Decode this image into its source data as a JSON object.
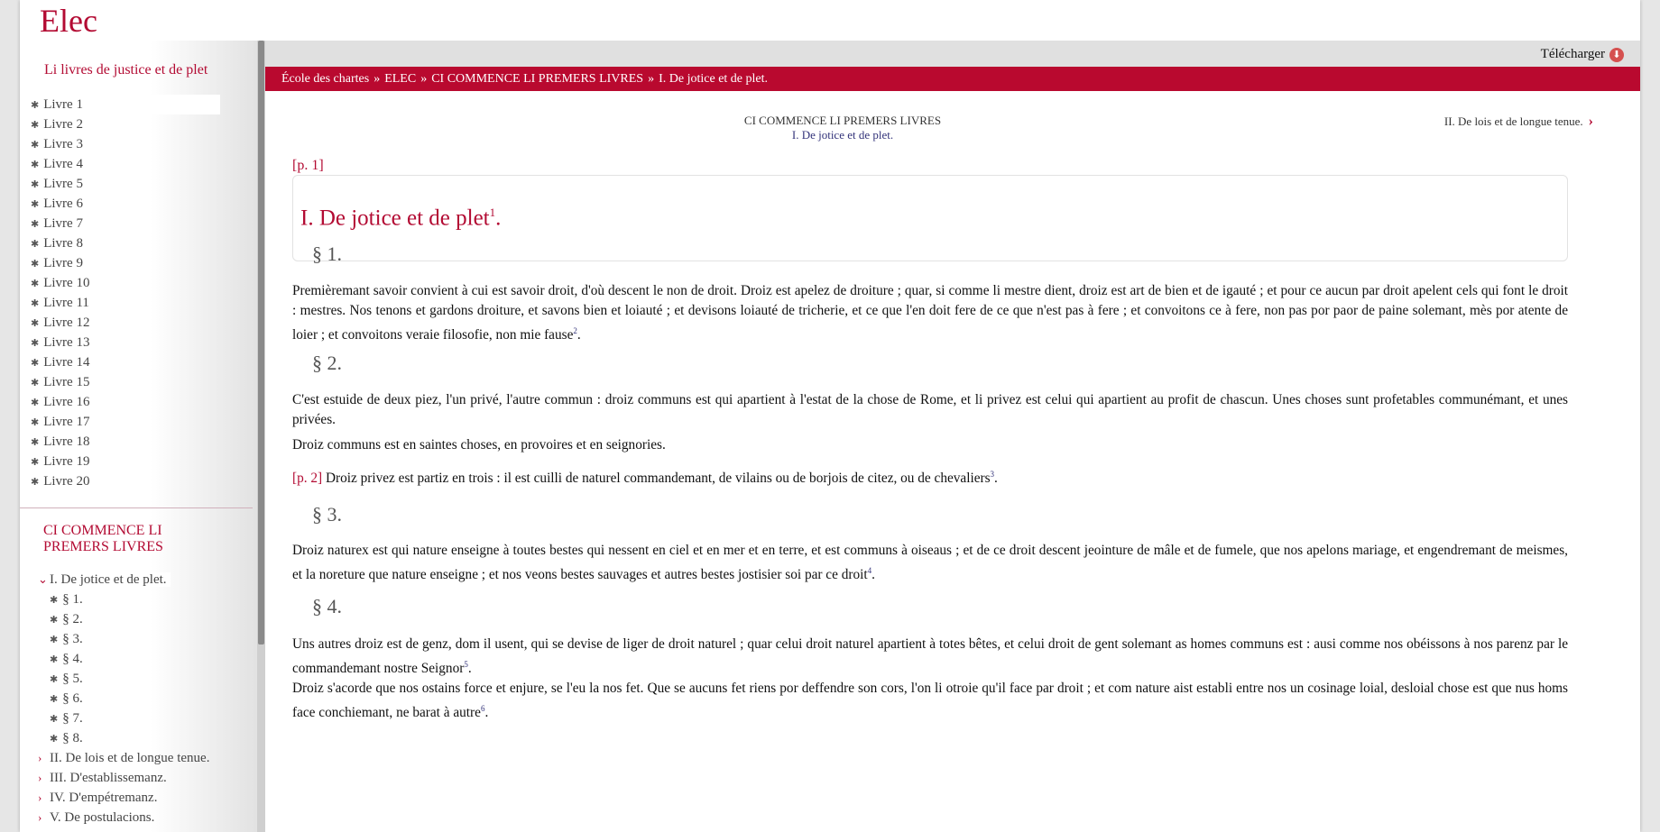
{
  "app": {
    "logo": "Elec"
  },
  "sidebar": {
    "title": "Li livres de justice et de plet",
    "books": [
      "Livre 1",
      "Livre 2",
      "Livre 3",
      "Livre 4",
      "Livre 5",
      "Livre 6",
      "Livre 7",
      "Livre 8",
      "Livre 9",
      "Livre 10",
      "Livre 11",
      "Livre 12",
      "Livre 13",
      "Livre 14",
      "Livre 15",
      "Livre 16",
      "Livre 17",
      "Livre 18",
      "Livre 19",
      "Livre 20"
    ],
    "section_title": "CI COMMENCE LI PREMERS LIVRES",
    "toc": {
      "current_chapter": "I. De jotice et de plet.",
      "paragraphs": [
        "§ 1.",
        "§ 2.",
        "§ 3.",
        "§ 4.",
        "§ 5.",
        "§ 6.",
        "§ 7.",
        "§ 8."
      ],
      "other_chapters": [
        "II. De lois et de longue tenue.",
        "III. D'establissemanz.",
        "IV. D'empétremanz.",
        "V. De postulacions."
      ]
    }
  },
  "topbar": {
    "download_label": "Télécharger"
  },
  "breadcrumb": [
    "École des chartes",
    "ELEC",
    "CI COMMENCE LI PREMERS LIVRES",
    "I. De jotice et de plet."
  ],
  "breadcrumb_separator": "»",
  "nav": {
    "book": "CI COMMENCE LI PREMERS LIVRES",
    "chapter": "I. De jotice et de plet.",
    "next": "II. De lois et de longue tenue."
  },
  "content": {
    "page1": "[p. 1]",
    "title": "I. De jotice et de plet",
    "title_note": "1",
    "title_end": ".",
    "sec1": "§ 1.",
    "sec1_text": "Premièremant savoir convient à cui est savoir droit, d'où descent le non de droit. Droiz est apelez de droiture ; quar, si comme li mestre dient, droiz est art de bien et de igauté ; et pour ce aucun par droit apelent cels qui font le droit : mestres. Nos tenons et gardons droiture, et savons bien et loiauté ; et devisons loiauté de tricherie, et ce que l'en doit fere de ce que n'est pas à fere ; et convoitons ce à fere, non pas por paor de paine solemant, mès por atente de loier ; et convoitons veraie filosofie, non mie fause",
    "sec1_note": "2",
    "sec2": "§ 2.",
    "sec2_text1": "C'est estuide de deux piez, l'un privé, l'autre commun : droiz communs est qui apartient à l'estat de la chose de Rome, et li privez est celui qui apartient au profit de chascun. Unes choses sunt profetables communémant, et unes privées.",
    "sec2_text2": "Droiz communs est en saintes choses, en provoires et en seignories.",
    "page2": "[p. 2]",
    "sec2_text3": "Droiz privez est partiz en trois : il est cuilli de naturel commandemant, de vilains ou de borjois de citez, ou de chevaliers",
    "sec2_note": "3",
    "sec3": "§ 3.",
    "sec3_text": "Droiz naturex est qui nature enseigne à toutes bestes qui nessent en ciel et en mer et en terre, et est communs à oiseaus ; et de ce droit descent jeointure de mâle et de fumele, que nos apelons mariage, et engendremant de meismes, et la noreture que nature enseigne ; et nos veons bestes sauvages et autres bestes jostisier soi par ce droit",
    "sec3_note": "4",
    "sec4": "§ 4.",
    "sec4_text1": "Uns autres droiz est de genz, dom il usent, qui se devise de liger de droit naturel ; quar celui droit naturel apartient à totes bêtes, et celui droit de gent solemant as homes communs est : ausi comme nos obéissons à nos parenz par le commandemant nostre Seignor",
    "sec4_note1": "5",
    "sec4_text2": "Droiz s'acorde que nos ostains force et enjure, se l'eu la nos fet. Que se aucuns fet riens por deffendre son cors, l'on li otroie qu'il face par droit ; et com nature aist establi entre nos un cosinage loial, desloial chose est que nus homs face conchiemant, ne barat à autre",
    "sec4_note2": "6",
    "period": "."
  }
}
